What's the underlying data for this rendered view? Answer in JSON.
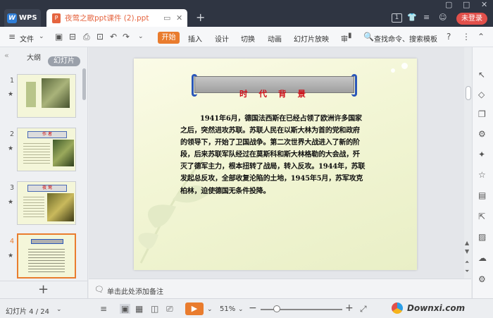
{
  "titlebar": {
    "app_tab": "WPS",
    "doc_icon": "P",
    "doc_title": "夜莺之歌ppt课件 (2).ppt",
    "badge": "1",
    "login": "未登录"
  },
  "ribbon": {
    "file": "文件",
    "tabs": [
      "开始",
      "插入",
      "设计",
      "切换",
      "动画",
      "幻灯片放映",
      "审"
    ],
    "search": "查找命令、搜索模板"
  },
  "left_panel": {
    "outline_tab": "大纲",
    "slides_tab": "幻灯片",
    "thumbs": [
      {
        "num": "1",
        "title": ""
      },
      {
        "num": "2",
        "title": "作 者"
      },
      {
        "num": "3",
        "title": "夜 莺"
      },
      {
        "num": "4",
        "title": "时代背景"
      }
    ]
  },
  "slide": {
    "title": "时 代 背 景",
    "body": "1941年6月，德国法西斯在已经占领了欧洲许多国家之后，突然进攻苏联。苏联人民在以斯大林为首的党和政府的领导下，开始了卫国战争。第二次世界大战进入了新的阶段，后来苏联军队经过在莫斯科和斯大林格勒的大会战，歼灭了德军主力，根本扭转了战局，转入反攻。1944年，苏联发起总反攻，全部收复沦陷的土地，1945年5月，苏军攻克柏林，迫使德国无条件投降。"
  },
  "notes": {
    "placeholder": "单击此处添加备注"
  },
  "status": {
    "slide_counter": "幻灯片 4 / 24",
    "zoom": "51%",
    "zoom_fraction": 0.2
  },
  "watermark": {
    "text": "Downxi.com"
  },
  "colors": {
    "accent": "#e97c2e",
    "login": "#e2504b",
    "title_red": "#d0121b"
  }
}
